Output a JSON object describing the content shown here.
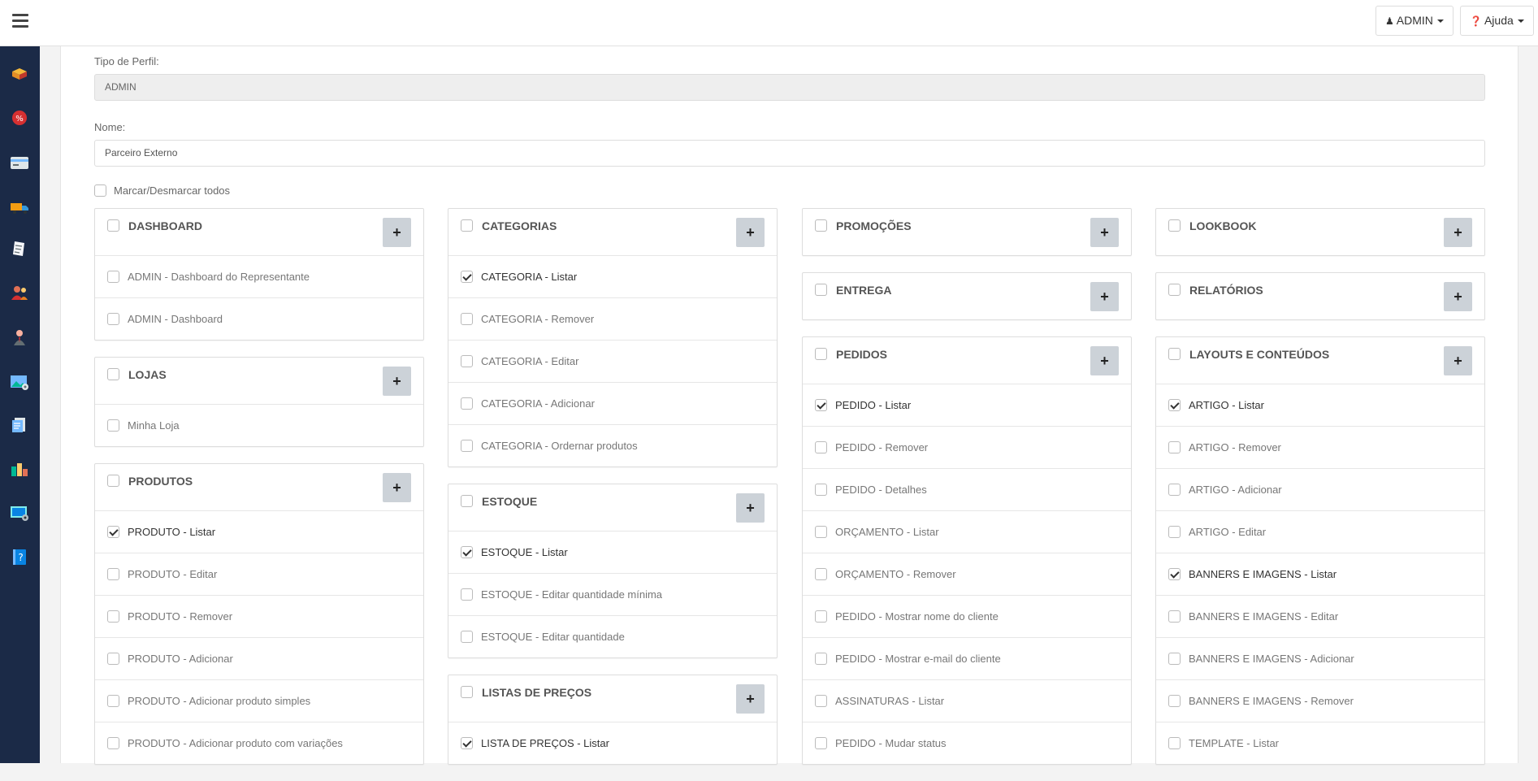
{
  "topbar": {
    "menu_icon": "hamburger-icon",
    "user_button": {
      "icon": "user-icon",
      "label": "ADMIN"
    },
    "help_button": {
      "icon": "question-circle-icon",
      "label": "Ajuda"
    }
  },
  "sidebar": {
    "items": [
      {
        "icon": "boxes-icon"
      },
      {
        "icon": "discount-badge-icon"
      },
      {
        "icon": "credit-card-icon"
      },
      {
        "icon": "delivery-truck-icon"
      },
      {
        "icon": "order-sheet-icon"
      },
      {
        "icon": "users-icon"
      },
      {
        "icon": "representative-icon"
      },
      {
        "icon": "picture-settings-icon"
      },
      {
        "icon": "document-list-icon"
      },
      {
        "icon": "bar-chart-icon"
      },
      {
        "icon": "screen-settings-icon"
      },
      {
        "icon": "help-book-icon"
      }
    ]
  },
  "form": {
    "profile_type_label": "Tipo de Perfil:",
    "profile_type_value": "ADMIN",
    "name_label": "Nome:",
    "name_value": "Parceiro Externo",
    "toggle_all_label": "Marcar/Desmarcar todos"
  },
  "columns": [
    {
      "groups": [
        {
          "title": "DASHBOARD",
          "items": [
            {
              "label": "ADMIN - Dashboard do Representante",
              "checked": false
            },
            {
              "label": "ADMIN - Dashboard",
              "checked": false
            }
          ]
        },
        {
          "title": "LOJAS",
          "items": [
            {
              "label": "Minha Loja",
              "checked": false
            }
          ]
        },
        {
          "title": "PRODUTOS",
          "items": [
            {
              "label": "PRODUTO - Listar",
              "checked": true
            },
            {
              "label": "PRODUTO - Editar",
              "checked": false
            },
            {
              "label": "PRODUTO - Remover",
              "checked": false
            },
            {
              "label": "PRODUTO - Adicionar",
              "checked": false
            },
            {
              "label": "PRODUTO - Adicionar produto simples",
              "checked": false
            },
            {
              "label": "PRODUTO - Adicionar produto com variações",
              "checked": false
            }
          ]
        }
      ]
    },
    {
      "groups": [
        {
          "title": "CATEGORIAS",
          "items": [
            {
              "label": "CATEGORIA - Listar",
              "checked": true
            },
            {
              "label": "CATEGORIA - Remover",
              "checked": false
            },
            {
              "label": "CATEGORIA - Editar",
              "checked": false
            },
            {
              "label": "CATEGORIA - Adicionar",
              "checked": false
            },
            {
              "label": "CATEGORIA - Ordernar produtos",
              "checked": false
            }
          ]
        },
        {
          "title": "ESTOQUE",
          "items": [
            {
              "label": "ESTOQUE - Listar",
              "checked": true
            },
            {
              "label": "ESTOQUE - Editar quantidade mínima",
              "checked": false
            },
            {
              "label": "ESTOQUE - Editar quantidade",
              "checked": false
            }
          ]
        },
        {
          "title": "LISTAS DE PREÇOS",
          "items": [
            {
              "label": "LISTA DE PREÇOS - Listar",
              "checked": true
            }
          ]
        }
      ]
    },
    {
      "groups": [
        {
          "title": "PROMOÇÕES",
          "items": []
        },
        {
          "title": "ENTREGA",
          "items": []
        },
        {
          "title": "PEDIDOS",
          "items": [
            {
              "label": "PEDIDO - Listar",
              "checked": true
            },
            {
              "label": "PEDIDO - Remover",
              "checked": false
            },
            {
              "label": "PEDIDO - Detalhes",
              "checked": false
            },
            {
              "label": "ORÇAMENTO - Listar",
              "checked": false
            },
            {
              "label": "ORÇAMENTO - Remover",
              "checked": false
            },
            {
              "label": "PEDIDO - Mostrar nome do cliente",
              "checked": false
            },
            {
              "label": "PEDIDO - Mostrar e-mail do cliente",
              "checked": false
            },
            {
              "label": "ASSINATURAS - Listar",
              "checked": false
            },
            {
              "label": "PEDIDO - Mudar status",
              "checked": false
            }
          ]
        }
      ]
    },
    {
      "groups": [
        {
          "title": "LOOKBOOK",
          "items": []
        },
        {
          "title": "RELATÓRIOS",
          "items": []
        },
        {
          "title": "LAYOUTS E CONTEÚDOS",
          "items": [
            {
              "label": "ARTIGO - Listar",
              "checked": true
            },
            {
              "label": "ARTIGO - Remover",
              "checked": false
            },
            {
              "label": "ARTIGO - Adicionar",
              "checked": false
            },
            {
              "label": "ARTIGO - Editar",
              "checked": false
            },
            {
              "label": "BANNERS E IMAGENS - Listar",
              "checked": true
            },
            {
              "label": "BANNERS E IMAGENS - Editar",
              "checked": false
            },
            {
              "label": "BANNERS E IMAGENS - Adicionar",
              "checked": false
            },
            {
              "label": "BANNERS E IMAGENS - Remover",
              "checked": false
            },
            {
              "label": "TEMPLATE - Listar",
              "checked": false
            }
          ]
        }
      ]
    }
  ]
}
